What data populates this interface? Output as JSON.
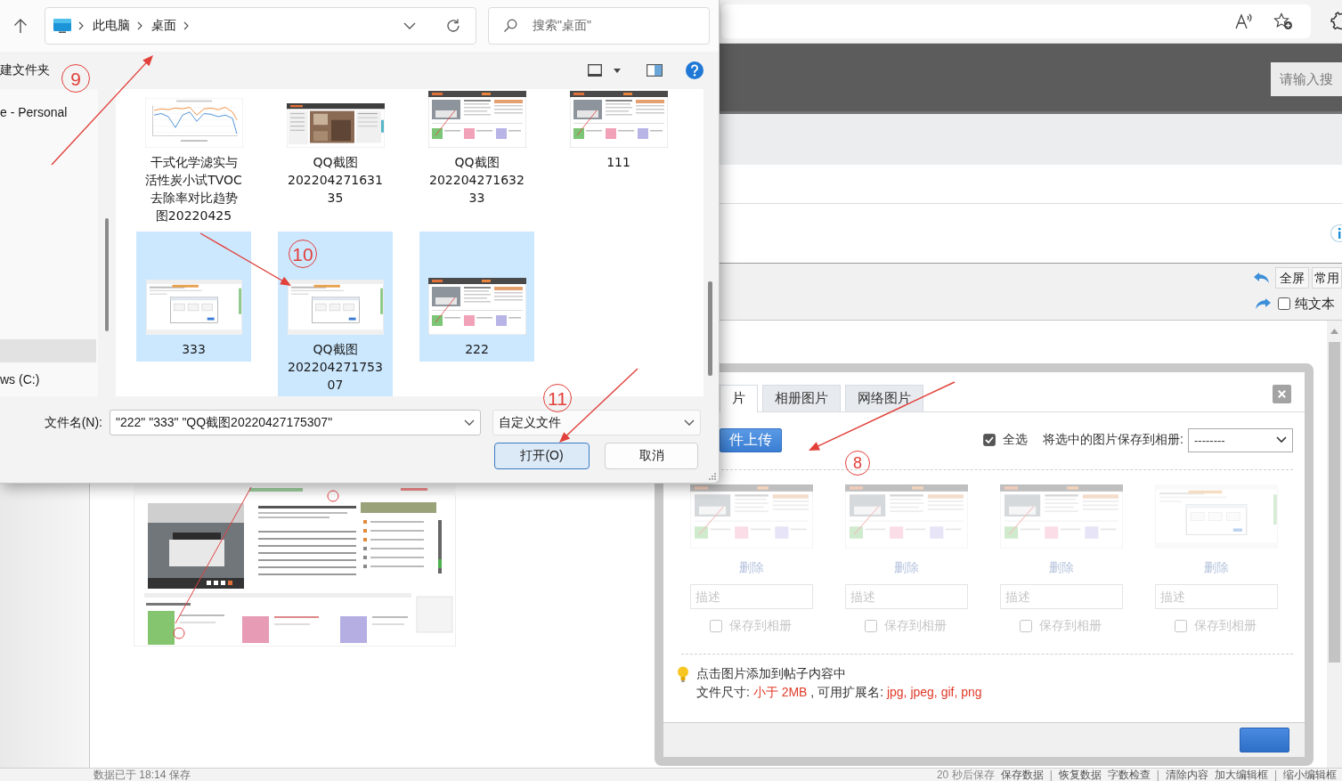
{
  "file_dialog": {
    "breadcrumb": [
      "此电脑",
      "桌面"
    ],
    "search_placeholder": "搜索\"桌面\"",
    "new_folder": "建文件夹",
    "nav_items": [
      {
        "label": "e - Personal",
        "selected": false
      },
      {
        "selected": true
      },
      {
        "label": "ws (C:)",
        "selected": false
      }
    ],
    "files": [
      {
        "name": "干式化学滤实与活性炭小试TVOC去除率对比趋势图20220425",
        "kind": "chart",
        "selected": false
      },
      {
        "name": "QQ截图20220427163135",
        "kind": "photo",
        "selected": false
      },
      {
        "name": "QQ截图20220427163233",
        "kind": "webpage",
        "selected": false
      },
      {
        "name": "111",
        "kind": "webpage",
        "selected": false
      },
      {
        "name": "333",
        "kind": "dialog",
        "selected": true
      },
      {
        "name": "QQ截图20220427175307",
        "kind": "dialog",
        "selected": true
      },
      {
        "name": "222",
        "kind": "webpage",
        "selected": true
      }
    ],
    "filename_label": "文件名(N):",
    "filename_value": "\"222\" \"333\" \"QQ截图20220427175307\"",
    "filetype": "自定义文件",
    "buttons": [
      {
        "label": "打开(O)",
        "kind": "primary"
      },
      {
        "label": "取消",
        "kind": "secondary"
      }
    ]
  },
  "browser": {
    "search_placeholder": "请输入搜"
  },
  "editor": {
    "toolbar_buttons": [
      "全屏",
      "常用"
    ],
    "plain_text": {
      "label": "纯文本",
      "checked": false
    },
    "status": "数据已于 18:14 保存",
    "status_items": [
      {
        "text": "20 秒后保存",
        "kind": "text"
      },
      {
        "text": "保存数据",
        "kind": "link"
      },
      {
        "text": "|",
        "kind": "separator"
      },
      {
        "text": "恢复数据",
        "kind": "link"
      },
      {
        "text": "字数检查",
        "kind": "link"
      },
      {
        "text": "|",
        "kind": "separator"
      },
      {
        "text": "清除内容",
        "kind": "link"
      },
      {
        "text": "加大编辑框",
        "kind": "link"
      },
      {
        "text": "|",
        "kind": "separator"
      },
      {
        "text": "缩小编辑框",
        "kind": "link"
      }
    ]
  },
  "upload_dialog": {
    "tabs": [
      {
        "label": "片",
        "selected": true
      },
      {
        "label": "相册图片",
        "selected": false
      },
      {
        "label": "网络图片",
        "selected": false
      }
    ],
    "upload_button": "件上传",
    "select_all": {
      "label": "全选",
      "checked": true
    },
    "save_to_album_label": "将选中的图片保存到相册:",
    "album_select": "--------",
    "images": [
      {
        "kind": "webpage",
        "delete": "删除",
        "description_placeholder": "描述",
        "save_label": "保存到相册",
        "checked": false
      },
      {
        "kind": "webpage",
        "delete": "删除",
        "description_placeholder": "描述",
        "save_label": "保存到相册",
        "checked": false
      },
      {
        "kind": "webpage",
        "delete": "删除",
        "description_placeholder": "描述",
        "save_label": "保存到相册",
        "checked": false
      },
      {
        "kind": "dialog",
        "delete": "删除",
        "description_placeholder": "描述",
        "save_label": "保存到相册",
        "checked": false
      }
    ],
    "tip": "点击图片添加到帖子内容中",
    "file_info": [
      {
        "text": "文件尺寸: ",
        "kind": "plain"
      },
      {
        "text": "小于 2MB",
        "kind": "highlight"
      },
      {
        "text": " , 可用扩展名: ",
        "kind": "plain"
      },
      {
        "text": "jpg, jpeg, gif, png",
        "kind": "highlight"
      }
    ]
  },
  "annotations": [
    "9",
    "10",
    "11",
    "8"
  ]
}
